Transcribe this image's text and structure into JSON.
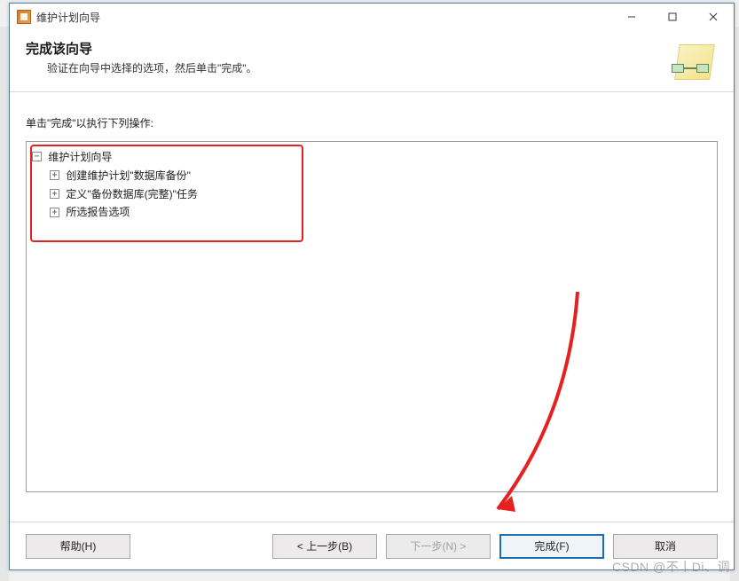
{
  "titlebar": {
    "title": "维护计划向导"
  },
  "header": {
    "title": "完成该向导",
    "subtitle": "验证在向导中选择的选项，然后单击\"完成\"。"
  },
  "content": {
    "instruction": "单击\"完成\"以执行下列操作:"
  },
  "tree": {
    "root": {
      "label": "维护计划向导",
      "expanded": true,
      "children": [
        {
          "label": "创建维护计划\"数据库备份\"",
          "expanded": false
        },
        {
          "label": "定义\"备份数据库(完整)\"任务",
          "expanded": false
        },
        {
          "label": "所选报告选项",
          "expanded": false
        }
      ]
    }
  },
  "buttons": {
    "help": "帮助(H)",
    "back": "< 上一步(B)",
    "next": "下一步(N) >",
    "finish": "完成(F)",
    "cancel": "取消"
  },
  "watermark": "CSDN @不丨Di、调"
}
